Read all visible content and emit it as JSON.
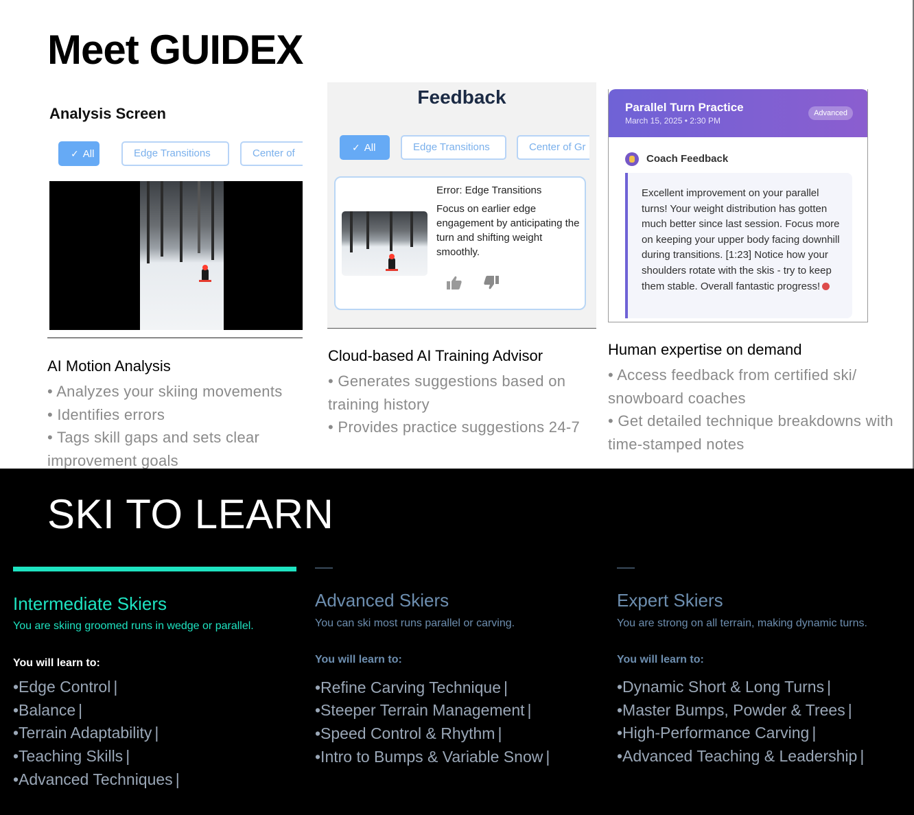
{
  "header": {
    "title": "Meet GUIDEX"
  },
  "columns": [
    {
      "screenshot_title": "Analysis Screen",
      "filters": [
        "All",
        "Edge Transitions",
        "Center of"
      ],
      "heading": "AI Motion Analysis",
      "bullets": [
        "• Analyzes your skiing movements",
        "• Identifies errors",
        "• Tags skill gaps and sets clear improvement goals"
      ]
    },
    {
      "screenshot_title": "Feedback",
      "filters": [
        "All",
        "Edge Transitions",
        "Center of Gr"
      ],
      "error_title": "Error: Edge Transitions",
      "error_text": "Focus on earlier edge engagement by anticipating the turn and shifting weight smoothly.",
      "heading": "Cloud-based AI Training Advisor",
      "bullets": [
        "• Generates  suggestions based on training history",
        "• Provides practice suggestions 24-7"
      ]
    },
    {
      "session_title": "Parallel Turn Practice",
      "session_date": "March 15, 2025 • 2:30 PM",
      "badge": "Advanced",
      "coach_label": "Coach Feedback",
      "feedback_text": "Excellent improvement on your parallel turns! Your weight distribution has gotten much better since last session. Focus more on keeping your upper body facing downhill during transitions. [1:23] Notice how your shoulders rotate with the skis - try to keep them stable. Overall fantastic progress!",
      "heading": "Human expertise on demand",
      "bullets": [
        "• Access feedback from certified ski/ snowboard coaches",
        "• Get detailed technique breakdowns with time-stamped notes"
      ]
    }
  ],
  "ski_section": {
    "title": "SKI TO LEARN",
    "learn_label": "You will learn to:",
    "levels": [
      {
        "name": "Intermediate Skiers",
        "subtitle": "You are skiing groomed runs in wedge or parallel.",
        "skills": [
          "•Edge Control",
          "•Balance",
          "•Terrain Adaptability",
          "•Teaching Skills",
          "•Advanced Techniques"
        ]
      },
      {
        "name": "Advanced Skiers",
        "subtitle": "You can ski most runs parallel or carving.",
        "skills": [
          "•Refine Carving Technique",
          "•Steeper Terrain Management",
          "•Speed Control & Rhythm",
          "•Intro to Bumps & Variable Snow"
        ]
      },
      {
        "name": "Expert Skiers",
        "subtitle": "You are strong on all terrain, making dynamic turns.",
        "skills": [
          "•Dynamic Short & Long Turns",
          "•Master Bumps, Powder & Trees",
          "•High-Performance Carving",
          "•Advanced Teaching & Leadership"
        ]
      }
    ],
    "separator": "|"
  },
  "colors": {
    "accent": "#1ee3c1",
    "muted": "#6d8eaf",
    "chip_blue": "#66aaf5",
    "coach_purple": "#6f62d6"
  },
  "icons": [
    "check-icon",
    "thumbs-up-icon",
    "thumbs-down-icon",
    "coach-avatar-icon"
  ]
}
